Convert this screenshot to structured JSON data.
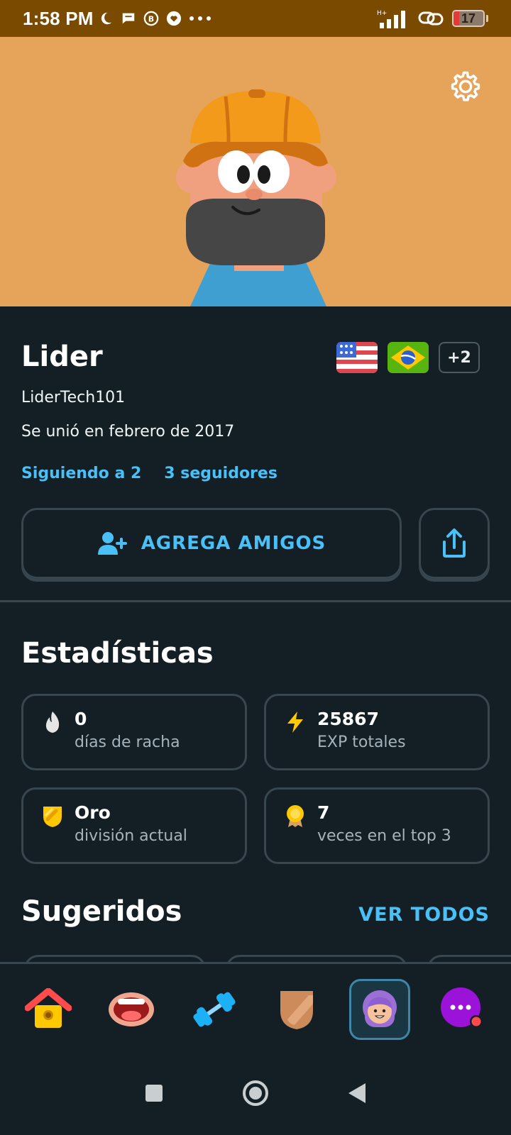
{
  "status_bar": {
    "time": "1:58 PM",
    "battery": "17",
    "signal_label": "H+"
  },
  "profile": {
    "name": "Lider",
    "username": "LiderTech101",
    "joined": "Se unió en febrero de 2017",
    "following": "Siguiendo a 2",
    "followers": "3 seguidores",
    "extra_courses": "+2",
    "courses": [
      "us-flag",
      "brazil-flag"
    ]
  },
  "actions": {
    "add_friends": "AGREGA AMIGOS"
  },
  "stats": {
    "title": "Estadísticas",
    "items": [
      {
        "value": "0",
        "label": "días de racha",
        "icon": "flame-icon"
      },
      {
        "value": "25867",
        "label": "EXP totales",
        "icon": "lightning-icon"
      },
      {
        "value": "Oro",
        "label": "división actual",
        "icon": "gold-league-icon"
      },
      {
        "value": "7",
        "label": "veces en el top 3",
        "icon": "medal-icon"
      }
    ]
  },
  "suggested": {
    "title": "Sugeridos",
    "see_all": "VER TODOS"
  },
  "nav": [
    "home",
    "speaking",
    "practice",
    "leagues",
    "profile",
    "more"
  ],
  "colors": {
    "background": "#131f24",
    "accent": "#49c0f8",
    "border": "#37464f",
    "hero_bg": "#e6a45a"
  }
}
